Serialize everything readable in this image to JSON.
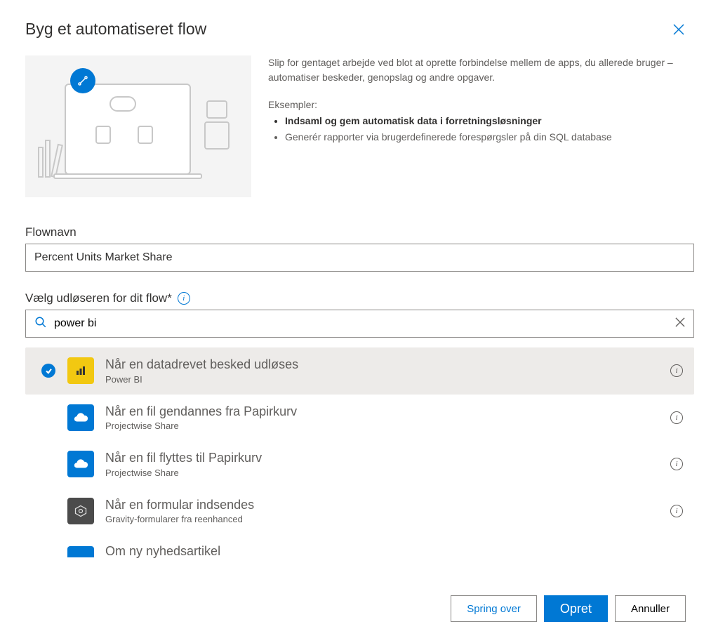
{
  "dialog": {
    "title": "Byg et automatiseret flow",
    "intro": {
      "description": "Slip for gentaget arbejde ved blot at oprette forbindelse mellem de apps, du allerede bruger – automatiser beskeder, genopslag og andre opgaver.",
      "examples_label": "Eksempler:",
      "examples": [
        "Indsaml og gem automatisk data i forretningsløsninger",
        "Generér rapporter via brugerdefinerede forespørgsler på din SQL database"
      ]
    },
    "flowname": {
      "label": "Flownavn",
      "value": "Percent Units Market Share"
    },
    "trigger_picker": {
      "label": "Vælg udløseren for dit flow*",
      "search_value": "power bi"
    },
    "triggers": [
      {
        "title": "Når en datadrevet besked udløses",
        "subtitle": "Power BI",
        "icon": "powerbi",
        "selected": true
      },
      {
        "title": "Når en fil gendannes fra Papirkurv",
        "subtitle": "Projectwise Share",
        "icon": "cloud",
        "selected": false
      },
      {
        "title": "Når en fil flyttes til Papirkurv",
        "subtitle": "Projectwise Share",
        "icon": "cloud",
        "selected": false
      },
      {
        "title": "Når en formular indsendes",
        "subtitle": "Gravity-formularer fra reenhanced",
        "icon": "form",
        "selected": false
      },
      {
        "title": "Om ny nyhedsartikel",
        "subtitle": "",
        "icon": "news",
        "selected": false
      }
    ],
    "footer": {
      "skip": "Spring over",
      "create": "Opret",
      "cancel": "Annuller"
    }
  }
}
